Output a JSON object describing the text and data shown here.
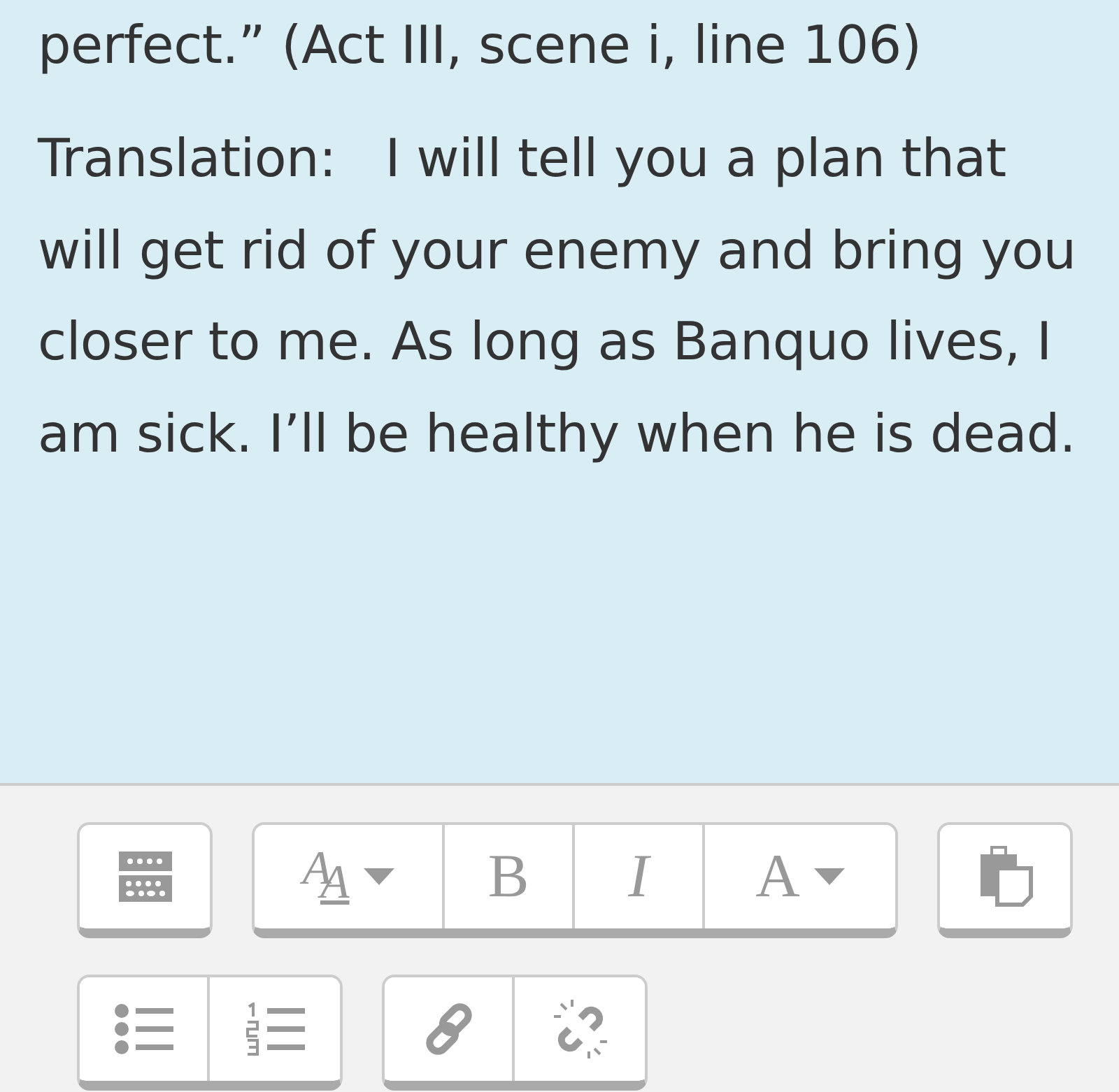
{
  "passage": {
    "paragraphs": [
      "perfect.” (Act III, scene i, line 106)",
      "Translation:   I will tell you a plan that will get rid of your enemy and bring you closer to me. As long as Banquo lives, I am sick. I’ll be healthy when he is dead."
    ]
  },
  "toolbar": {
    "rows": [
      [
        {
          "buttons": [
            {
              "kind": "toggle-toolbar"
            }
          ]
        },
        {
          "buttons": [
            {
              "kind": "font-size",
              "label": "A$_{A}$"
            },
            {
              "kind": "bold",
              "label": "B"
            },
            {
              "kind": "italic",
              "label": "I"
            },
            {
              "kind": "font-color",
              "label": "A"
            }
          ]
        },
        {
          "buttons": [
            {
              "kind": "paste"
            }
          ]
        }
      ],
      [
        {
          "buttons": [
            {
              "kind": "bullet-list"
            },
            {
              "kind": "numbered-list"
            }
          ]
        },
        {
          "buttons": [
            {
              "kind": "link"
            },
            {
              "kind": "unlink"
            }
          ]
        }
      ]
    ]
  }
}
